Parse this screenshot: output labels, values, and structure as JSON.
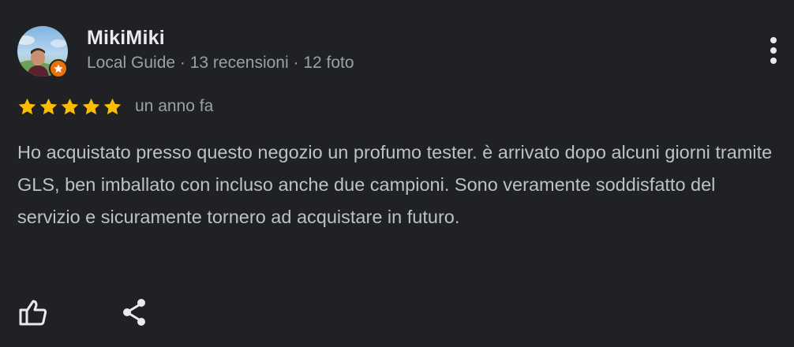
{
  "review": {
    "author": {
      "name": "MikiMiki",
      "meta": "Local Guide · 13 recensioni · 12 foto",
      "avatar_icon": "profile-photo",
      "badge_icon": "local-guide-star-icon",
      "badge_color": "#e8710a"
    },
    "rating": {
      "stars": 5,
      "max": 5,
      "star_color": "#fbbc04"
    },
    "date": "un anno fa",
    "text": "Ho acquistato presso questo negozio un profumo tester. è arrivato dopo alcuni giorni tramite GLS, ben imballato con incluso anche due campioni. Sono veramente soddisfatto del servizio e sicuramente tornero ad acquistare in futuro.",
    "actions": {
      "like_icon": "thumb-up-icon",
      "share_icon": "share-icon",
      "more_icon": "more-vert-icon"
    }
  },
  "theme": {
    "background": "#202124",
    "primary_text": "#e8eaed",
    "secondary_text": "#9aa0a6",
    "body_text": "#bdc1c6"
  }
}
